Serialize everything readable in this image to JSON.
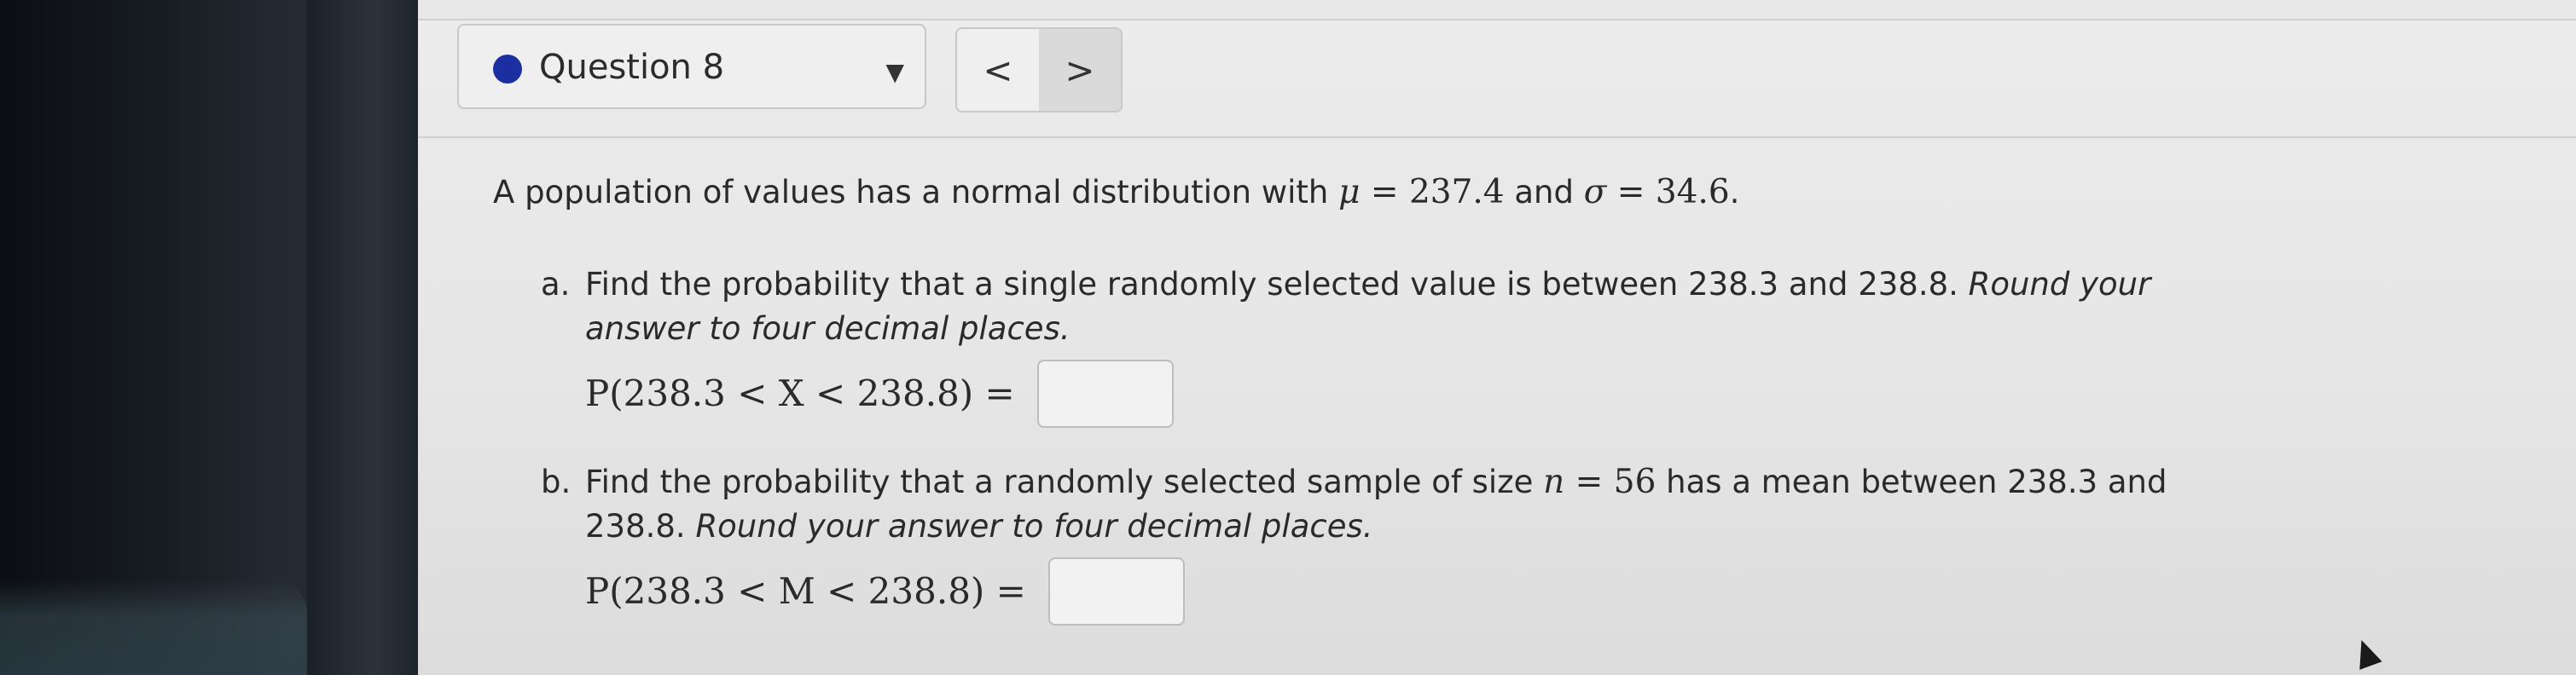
{
  "header": {
    "question_label": "Question 8",
    "prev_glyph": "<",
    "next_glyph": ">",
    "dropdown_caret": "▼"
  },
  "problem": {
    "intro_text": "A population of values has a normal distribution with ",
    "mu_symbol": "μ",
    "mu_eq": " = 237.4",
    "and_text": " and ",
    "sigma_symbol": "σ",
    "sigma_eq": " = 34.6",
    "period": ".",
    "part_a": {
      "letter": "a.",
      "text": "Find the probability that a single randomly selected value is between 238.3 and 238.8. ",
      "instruction": "Round your answer to four decimal places.",
      "equation": "P(238.3 < X < 238.8) =",
      "answer_value": ""
    },
    "part_b": {
      "letter": "b.",
      "text_before_n": "Find the probability that a randomly selected sample of size ",
      "n_symbol": "n",
      "n_eq": " = 56",
      "text_after_n": " has a mean between 238.3 and 238.8. ",
      "instruction": "Round your answer to four decimal places.",
      "equation": "P(238.3 < M < 238.8) =",
      "answer_value": ""
    }
  },
  "colors": {
    "question_dot": "#1c2fa0",
    "page_background": "#e8e8e8",
    "text": "#2a2a2a"
  },
  "icons": {
    "question_status": "status-dot-icon",
    "dropdown": "chevron-down-icon",
    "prev": "chevron-left-icon",
    "next": "chevron-right-icon",
    "cursor": "mouse-pointer-icon"
  }
}
